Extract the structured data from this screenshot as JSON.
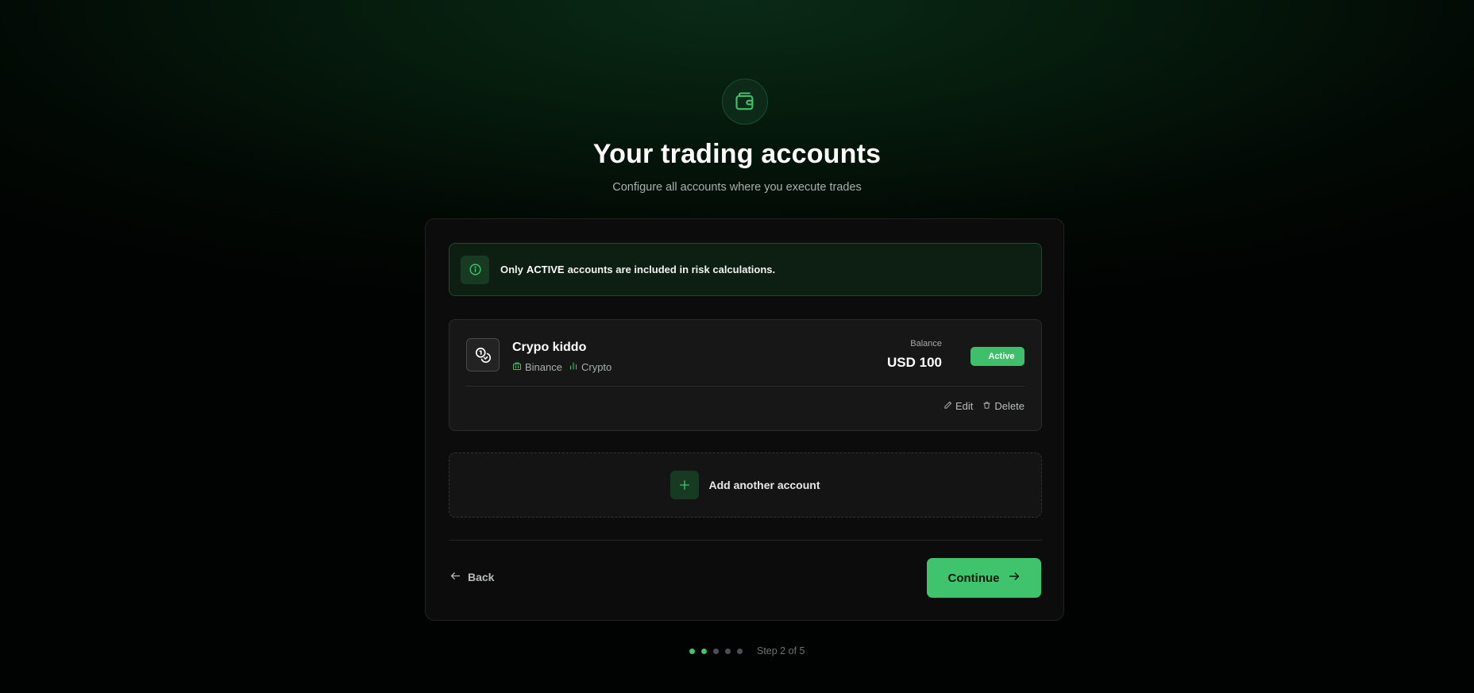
{
  "header": {
    "icon": "wallet-icon",
    "title": "Your trading accounts",
    "subtitle": "Configure all accounts where you execute trades"
  },
  "notice": {
    "icon": "info-icon",
    "prefix": "Only",
    "highlight": "ACTIVE",
    "suffix": "accounts are included in risk calculations."
  },
  "account": {
    "icon": "coins-icon",
    "name": "Crypo kiddo",
    "broker": "Binance",
    "broker_icon": "building-icon",
    "market": "Crypto",
    "market_icon": "bar-chart-icon",
    "balance_label": "Balance",
    "balance_value": "USD 100",
    "status": "Active",
    "edit_label": "Edit",
    "delete_label": "Delete"
  },
  "add_account": {
    "label": "Add another account",
    "icon": "plus-icon"
  },
  "footer": {
    "back_label": "Back",
    "continue_label": "Continue"
  },
  "progress": {
    "current": 2,
    "total": 5,
    "label": "Step 2 of 5"
  },
  "colors": {
    "accent": "#3fc36c",
    "background": "#020904",
    "card": "#0c0c0c"
  }
}
